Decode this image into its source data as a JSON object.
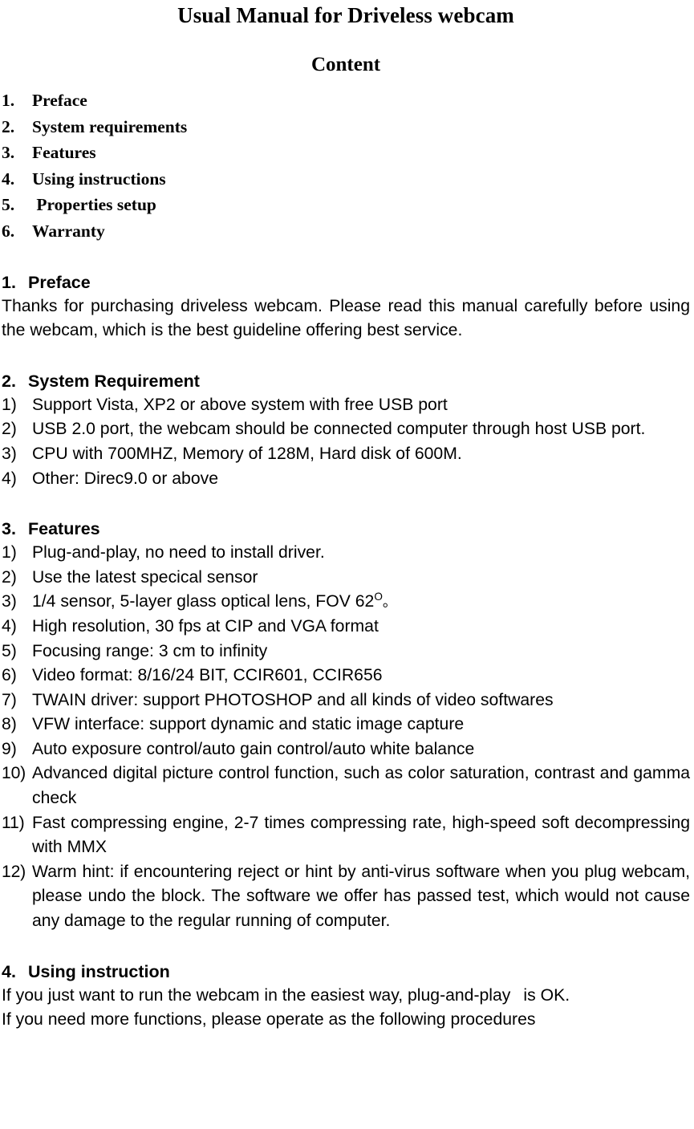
{
  "document": {
    "title": "Usual Manual for Driveless webcam",
    "content_heading": "Content"
  },
  "toc": {
    "items": [
      {
        "num": "1.",
        "label": "Preface"
      },
      {
        "num": "2.",
        "label": "System requirements"
      },
      {
        "num": "3.",
        "label": "Features"
      },
      {
        "num": "4.",
        "label": "Using instructions"
      },
      {
        "num": "5.",
        "label": " Properties setup"
      },
      {
        "num": "6.",
        "label": "Warranty"
      }
    ]
  },
  "sections": {
    "preface": {
      "num": "1.",
      "heading": "Preface",
      "body": "Thanks for purchasing driveless webcam. Please read this manual carefully before using the webcam, which is the best guideline offering best service."
    },
    "system_requirement": {
      "num": "2.",
      "heading": "System Requirement",
      "items": [
        {
          "marker": "1)",
          "text": "Support Vista, XP2 or above system with free USB port"
        },
        {
          "marker": "2)",
          "text": "USB 2.0 port, the webcam should be connected computer through host USB port."
        },
        {
          "marker": "3)",
          "text": "CPU with 700MHZ, Memory of 128M, Hard disk of 600M."
        },
        {
          "marker": "4)",
          "text": "Other: Direc9.0 or above"
        }
      ]
    },
    "features": {
      "num": "3.",
      "heading": "Features",
      "items": [
        {
          "marker": "1)",
          "text": "Plug-and-play, no need to install driver."
        },
        {
          "marker": "2)",
          "text": "Use the latest specical sensor"
        },
        {
          "marker": "3)",
          "text": "1/4 sensor, 5-layer glass optical lens, FOV 62",
          "superscript": "O",
          "suffix": "。"
        },
        {
          "marker": "4)",
          "text": "High resolution, 30 fps at CIP and VGA format"
        },
        {
          "marker": "5)",
          "text": "Focusing range: 3 cm to infinity"
        },
        {
          "marker": "6)",
          "text": "Video format: 8/16/24 BIT, CCIR601, CCIR656"
        },
        {
          "marker": "7)",
          "text": "TWAIN driver: support PHOTOSHOP and all kinds of video softwares"
        },
        {
          "marker": "8)",
          "text": "VFW interface: support dynamic and static image capture"
        },
        {
          "marker": "9)",
          "text": "Auto exposure control/auto gain control/auto white balance"
        },
        {
          "marker": "10)",
          "text": "Advanced digital picture control function, such as color saturation, contrast and gamma check"
        },
        {
          "marker": "11)",
          "text": "Fast compressing engine, 2-7 times compressing rate, high-speed soft decompressing with MMX"
        },
        {
          "marker": "12)",
          "text": "Warm hint: if encountering reject or hint by anti-virus software when you plug webcam, please undo the block. The software we offer has passed test, which would not cause any damage to the regular running of computer."
        }
      ]
    },
    "using_instruction": {
      "num": "4.",
      "heading": "Using instruction",
      "line1_a": "If you just want to run the webcam in the easiest way, plug-and-play",
      "line1_b": "is OK.",
      "line2": "If you need more functions, please operate as the following procedures"
    }
  }
}
